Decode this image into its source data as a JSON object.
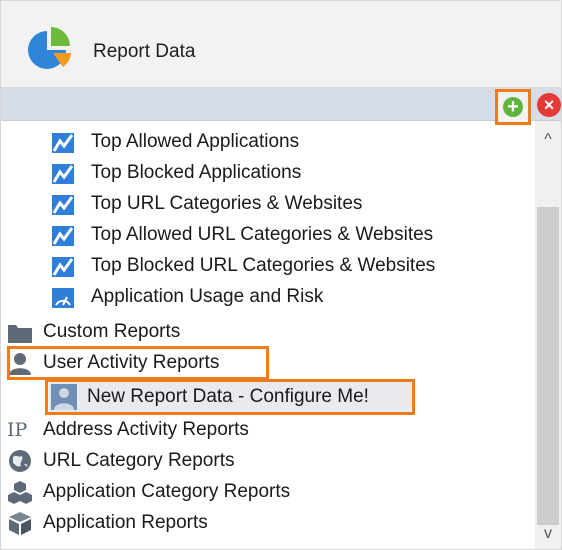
{
  "header": {
    "title": "Report Data",
    "icon": "pie-chart-icon"
  },
  "toolbar": {
    "add_icon": "add-icon",
    "add_glyph": "+",
    "remove_icon": "remove-icon",
    "remove_glyph": "×"
  },
  "tree": {
    "children": [
      {
        "label": "Top Allowed Applications",
        "icon": "report-chart-icon"
      },
      {
        "label": "Top Blocked Applications",
        "icon": "report-chart-icon"
      },
      {
        "label": "Top URL Categories & Websites",
        "icon": "report-chart-icon"
      },
      {
        "label": "Top Allowed URL Categories & Websites",
        "icon": "report-chart-icon"
      },
      {
        "label": "Top Blocked URL Categories & Websites",
        "icon": "report-chart-icon"
      },
      {
        "label": "Application Usage and Risk",
        "icon": "risk-gauge-icon"
      }
    ],
    "groups": [
      {
        "label": "Custom Reports",
        "icon": "folder-icon"
      },
      {
        "label": "User Activity Reports",
        "icon": "user-icon"
      },
      {
        "label": "New Report Data - Configure Me!",
        "icon": "user-icon"
      },
      {
        "label": "Address Activity Reports",
        "icon": "ip-icon",
        "icon_text": "IP"
      },
      {
        "label": "URL Category Reports",
        "icon": "globe-icon"
      },
      {
        "label": "Application Category Reports",
        "icon": "cubes-icon"
      },
      {
        "label": "Application Reports",
        "icon": "cube-icon"
      }
    ]
  },
  "scrollbar": {
    "up_glyph": "^",
    "down_glyph": "v"
  },
  "colors": {
    "accent": "#f07b1b",
    "add": "#5fb53a",
    "remove": "#e53935",
    "toolbar": "#d7dde6"
  }
}
